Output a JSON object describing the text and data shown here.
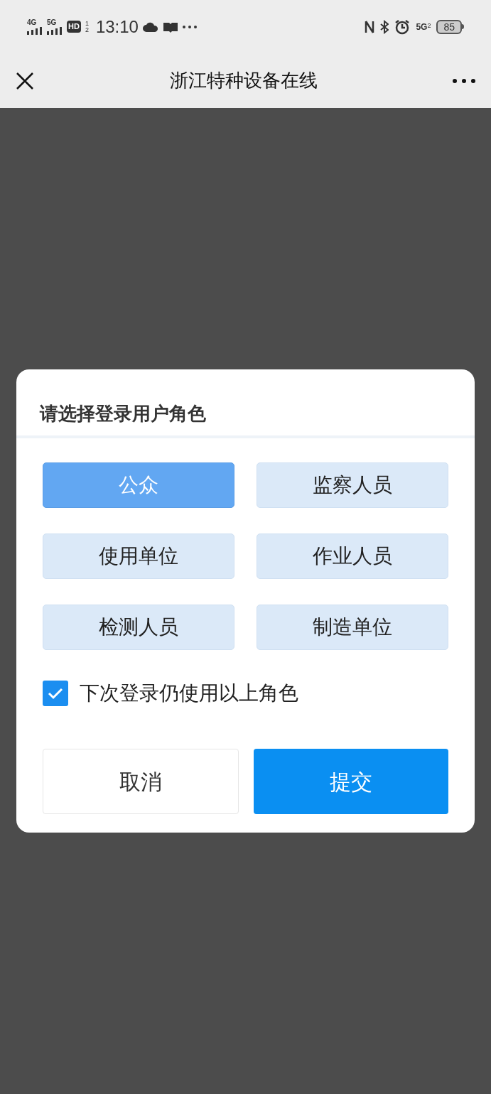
{
  "status_bar": {
    "network_labels": [
      "4G",
      "5G"
    ],
    "hd": "HD",
    "hd_sims": [
      "1",
      "2"
    ],
    "time": "13:10",
    "right_network": "5G",
    "right_network_sim": "2",
    "battery": "85"
  },
  "nav_bar": {
    "title": "浙江特种设备在线"
  },
  "dialog": {
    "title": "请选择登录用户角色",
    "roles": [
      {
        "label": "公众",
        "selected": true
      },
      {
        "label": "监察人员",
        "selected": false
      },
      {
        "label": "使用单位",
        "selected": false
      },
      {
        "label": "作业人员",
        "selected": false
      },
      {
        "label": "检测人员",
        "selected": false
      },
      {
        "label": "制造单位",
        "selected": false
      }
    ],
    "remember": {
      "label": "下次登录仍使用以上角色",
      "checked": true
    },
    "buttons": [
      {
        "label": "取消",
        "kind": "secondary"
      },
      {
        "label": "提交",
        "kind": "primary"
      }
    ]
  }
}
